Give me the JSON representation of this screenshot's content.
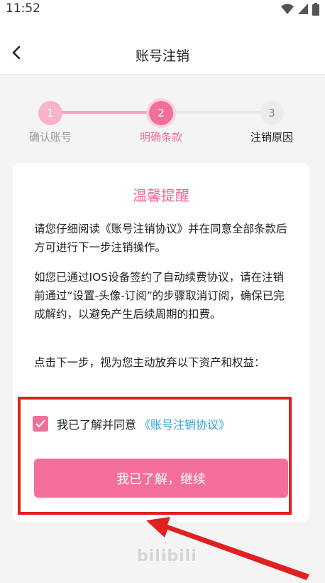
{
  "status_bar": {
    "time": "11:52"
  },
  "nav": {
    "title": "账号注销"
  },
  "steps": [
    {
      "number": "1",
      "label": "确认账号"
    },
    {
      "number": "2",
      "label": "明确条款"
    },
    {
      "number": "3",
      "label": "注销原因"
    }
  ],
  "card": {
    "title": "温馨提醒",
    "paragraph1": "请您仔细阅读《账号注销协议》并在同意全部条款后方可进行下一步注销操作。",
    "paragraph2": "如您已通过IOS设备签约了自动续费协议，请在注销前通过“设置-头像-订阅”的步骤取消订阅，确保已完成解约，以避免产生后续周期的扣费。",
    "paragraph3": "点击下一步，视为您主动放弃以下资产和权益：",
    "agree_text": "我已了解并同意",
    "agree_link": "《账号注销协议》",
    "agree_checked": true,
    "continue_label": "我已了解，继续"
  },
  "footer": {
    "logo": "bilibili"
  },
  "colors": {
    "accent": "#f36f9a",
    "link": "#2aa3d8",
    "annotation": "#e02020"
  }
}
